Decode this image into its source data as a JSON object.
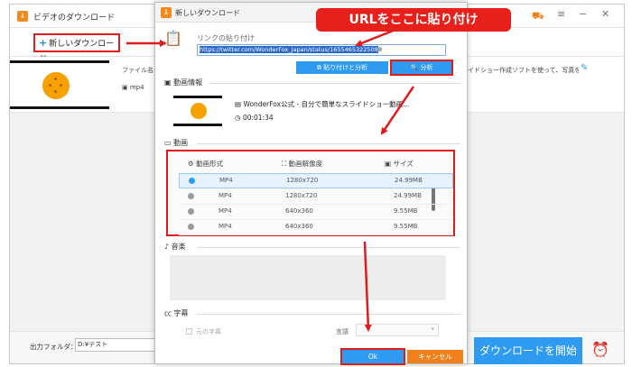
{
  "app": {
    "title": "ビデオのダウンロード",
    "new_download_label": "新しいダウンロード",
    "file_name_label": "ファイル名: V",
    "format_value": "mp4",
    "task_desc": "ライドショー作成ソフトを使って、写真をス...",
    "output_folder_label": "出力フォルダ：",
    "output_folder_value": "D:¥テスト",
    "download_start_label": "ダウンロードを開始"
  },
  "dialog": {
    "title": "新しいダウンロード",
    "paste_link_label": "リンクの貼り付け",
    "url_value": "https://twitter.com/WonderFox_Japan/status/1655465322508",
    "url_value_tail": "8",
    "paste_analyze_label": "貼り付けと分析",
    "analyze_label": "分析",
    "video_info_label": "動画情報",
    "video_title": "WonderFox公式 - 自分で簡単なスライドショー動画...",
    "video_duration": "00:01:34",
    "video_section_label": "動画",
    "columns": {
      "format": "動画形式",
      "resolution": "動画解像度",
      "size": "サイズ"
    },
    "rows": [
      {
        "format": "MP4",
        "resolution": "1280x720",
        "size": "24.99MB"
      },
      {
        "format": "MP4",
        "resolution": "1280x720",
        "size": "24.99MB"
      },
      {
        "format": "MP4",
        "resolution": "640x360",
        "size": "9.55MB"
      },
      {
        "format": "MP4",
        "resolution": "640x360",
        "size": "9.55MB"
      }
    ],
    "audio_section_label": "音楽",
    "subtitle_section_label": "字幕",
    "original_subtitle_label": "元の字幕",
    "language_label": "言語",
    "ok_label": "Ok",
    "cancel_label": "キャンセル"
  },
  "annotation": {
    "callout_text": "URLをここに貼り付け"
  },
  "colors": {
    "accent_blue": "#2f9bf0",
    "annotation_red": "#e01b1b",
    "cancel_orange": "#f0801c"
  }
}
